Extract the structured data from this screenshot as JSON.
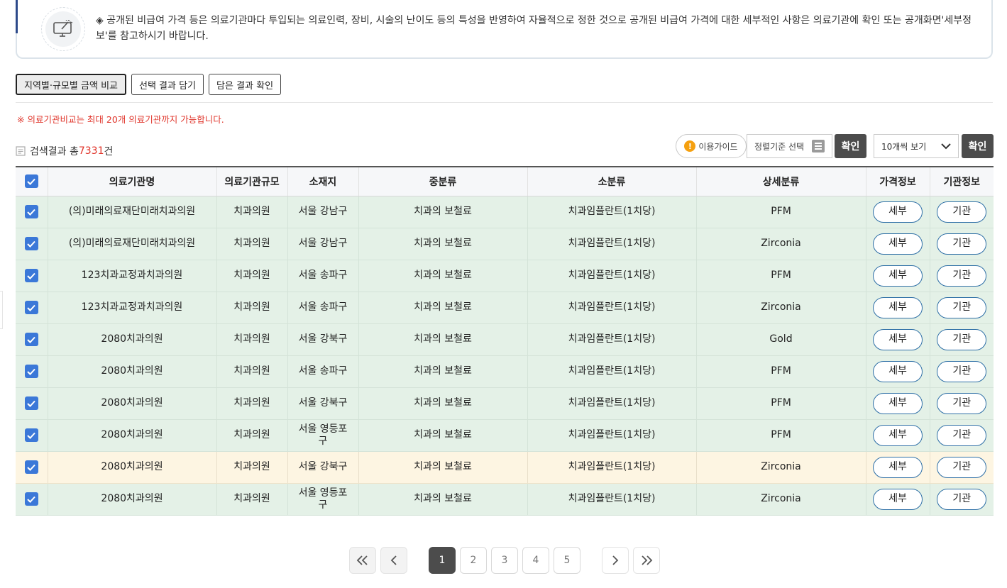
{
  "notice": {
    "text": "◈ 공개된 비급여 가격 등은 의료기관마다 투입되는 의료인력, 장비, 시술의 난이도 등의 특성을 반영하여 자율적으로 정한 것으로 공개된 비급여 가격에 대한 세부적인 사항은 의료기관에 확인 또는 공개화면'세부정보'를 참고하시기 바랍니다."
  },
  "actions": {
    "compare": "지역별·규모별 금액 비교",
    "save": "선택 결과 담기",
    "view": "담은 결과 확인"
  },
  "warning": "※ 의료기관비교는 최대 20개 의료기관까지 가능합니다.",
  "results": {
    "prefix": "검색결과 총",
    "count": "7331",
    "suffix": "건"
  },
  "toolbar": {
    "guide": "이용가이드",
    "guide_badge": "!",
    "sort": "정렬기준 선택",
    "confirm1": "확인",
    "page_size": "10개씩 보기",
    "confirm2": "확인"
  },
  "table": {
    "headers": [
      "의료기관명",
      "의료기관규모",
      "소재지",
      "중분류",
      "소분류",
      "상세분류",
      "가격정보",
      "기관정보"
    ],
    "detail_label": "세부",
    "inst_label": "기관",
    "rows": [
      {
        "name": "(의)미래의료재단미래치과의원",
        "size": "치과의원",
        "loc": "서울 강남구",
        "mid": "치과의 보철료",
        "sub": "치과임플란트(1치당)",
        "detail": "PFM",
        "highlight": false
      },
      {
        "name": "(의)미래의료재단미래치과의원",
        "size": "치과의원",
        "loc": "서울 강남구",
        "mid": "치과의 보철료",
        "sub": "치과임플란트(1치당)",
        "detail": "Zirconia",
        "highlight": false
      },
      {
        "name": "123치과교정과치과의원",
        "size": "치과의원",
        "loc": "서울 송파구",
        "mid": "치과의 보철료",
        "sub": "치과임플란트(1치당)",
        "detail": "PFM",
        "highlight": false
      },
      {
        "name": "123치과교정과치과의원",
        "size": "치과의원",
        "loc": "서울 송파구",
        "mid": "치과의 보철료",
        "sub": "치과임플란트(1치당)",
        "detail": "Zirconia",
        "highlight": false
      },
      {
        "name": "2080치과의원",
        "size": "치과의원",
        "loc": "서울 강북구",
        "mid": "치과의 보철료",
        "sub": "치과임플란트(1치당)",
        "detail": "Gold",
        "highlight": false
      },
      {
        "name": "2080치과의원",
        "size": "치과의원",
        "loc": "서울 송파구",
        "mid": "치과의 보철료",
        "sub": "치과임플란트(1치당)",
        "detail": "PFM",
        "highlight": false
      },
      {
        "name": "2080치과의원",
        "size": "치과의원",
        "loc": "서울 강북구",
        "mid": "치과의 보철료",
        "sub": "치과임플란트(1치당)",
        "detail": "PFM",
        "highlight": false
      },
      {
        "name": "2080치과의원",
        "size": "치과의원",
        "loc": "서울 영등포구",
        "mid": "치과의 보철료",
        "sub": "치과임플란트(1치당)",
        "detail": "PFM",
        "highlight": false
      },
      {
        "name": "2080치과의원",
        "size": "치과의원",
        "loc": "서울 강북구",
        "mid": "치과의 보철료",
        "sub": "치과임플란트(1치당)",
        "detail": "Zirconia",
        "highlight": true
      },
      {
        "name": "2080치과의원",
        "size": "치과의원",
        "loc": "서울 영등포구",
        "mid": "치과의 보철료",
        "sub": "치과임플란트(1치당)",
        "detail": "Zirconia",
        "highlight": false
      }
    ]
  },
  "pagination": {
    "first": "«",
    "prev": "‹",
    "pages": [
      "1",
      "2",
      "3",
      "4",
      "5"
    ],
    "current": "1",
    "next": "›",
    "last": "»"
  },
  "colors": {
    "accent_red": "#e0352b",
    "checkbox_blue": "#3b78d8",
    "row_green": "#e4f1e7",
    "row_highlight": "#fdf5e2",
    "dark_button": "#4c4c4c"
  }
}
